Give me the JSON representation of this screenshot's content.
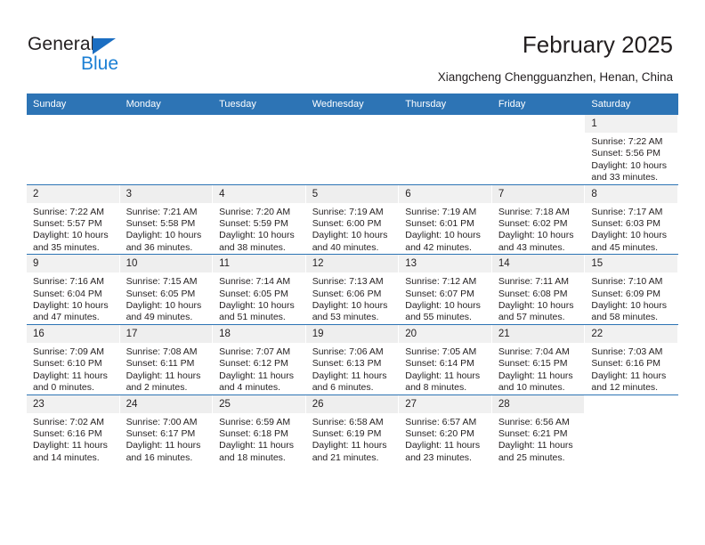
{
  "brand": {
    "name_primary": "General",
    "name_secondary": "Blue",
    "accent_color": "#1b7fd4",
    "triangle_color": "#1b6ec2"
  },
  "header": {
    "title": "February 2025",
    "location": "Xiangcheng Chengguanzhen, Henan, China"
  },
  "theme": {
    "header_blue": "#2d74b5",
    "daynum_band": "#f1f1f1",
    "text": "#231f20"
  },
  "weekdays": [
    "Sunday",
    "Monday",
    "Tuesday",
    "Wednesday",
    "Thursday",
    "Friday",
    "Saturday"
  ],
  "labels": {
    "sunrise": "Sunrise:",
    "sunset": "Sunset:",
    "daylight": "Daylight:"
  },
  "weeks": [
    [
      {
        "day": "",
        "sunrise": "",
        "sunset": "",
        "daylight": "",
        "empty": true
      },
      {
        "day": "",
        "sunrise": "",
        "sunset": "",
        "daylight": "",
        "empty": true
      },
      {
        "day": "",
        "sunrise": "",
        "sunset": "",
        "daylight": "",
        "empty": true
      },
      {
        "day": "",
        "sunrise": "",
        "sunset": "",
        "daylight": "",
        "empty": true
      },
      {
        "day": "",
        "sunrise": "",
        "sunset": "",
        "daylight": "",
        "empty": true
      },
      {
        "day": "",
        "sunrise": "",
        "sunset": "",
        "daylight": "",
        "empty": true
      },
      {
        "day": "1",
        "sunrise": "Sunrise: 7:22 AM",
        "sunset": "Sunset: 5:56 PM",
        "daylight": "Daylight: 10 hours and 33 minutes."
      }
    ],
    [
      {
        "day": "2",
        "sunrise": "Sunrise: 7:22 AM",
        "sunset": "Sunset: 5:57 PM",
        "daylight": "Daylight: 10 hours and 35 minutes."
      },
      {
        "day": "3",
        "sunrise": "Sunrise: 7:21 AM",
        "sunset": "Sunset: 5:58 PM",
        "daylight": "Daylight: 10 hours and 36 minutes."
      },
      {
        "day": "4",
        "sunrise": "Sunrise: 7:20 AM",
        "sunset": "Sunset: 5:59 PM",
        "daylight": "Daylight: 10 hours and 38 minutes."
      },
      {
        "day": "5",
        "sunrise": "Sunrise: 7:19 AM",
        "sunset": "Sunset: 6:00 PM",
        "daylight": "Daylight: 10 hours and 40 minutes."
      },
      {
        "day": "6",
        "sunrise": "Sunrise: 7:19 AM",
        "sunset": "Sunset: 6:01 PM",
        "daylight": "Daylight: 10 hours and 42 minutes."
      },
      {
        "day": "7",
        "sunrise": "Sunrise: 7:18 AM",
        "sunset": "Sunset: 6:02 PM",
        "daylight": "Daylight: 10 hours and 43 minutes."
      },
      {
        "day": "8",
        "sunrise": "Sunrise: 7:17 AM",
        "sunset": "Sunset: 6:03 PM",
        "daylight": "Daylight: 10 hours and 45 minutes."
      }
    ],
    [
      {
        "day": "9",
        "sunrise": "Sunrise: 7:16 AM",
        "sunset": "Sunset: 6:04 PM",
        "daylight": "Daylight: 10 hours and 47 minutes."
      },
      {
        "day": "10",
        "sunrise": "Sunrise: 7:15 AM",
        "sunset": "Sunset: 6:05 PM",
        "daylight": "Daylight: 10 hours and 49 minutes."
      },
      {
        "day": "11",
        "sunrise": "Sunrise: 7:14 AM",
        "sunset": "Sunset: 6:05 PM",
        "daylight": "Daylight: 10 hours and 51 minutes."
      },
      {
        "day": "12",
        "sunrise": "Sunrise: 7:13 AM",
        "sunset": "Sunset: 6:06 PM",
        "daylight": "Daylight: 10 hours and 53 minutes."
      },
      {
        "day": "13",
        "sunrise": "Sunrise: 7:12 AM",
        "sunset": "Sunset: 6:07 PM",
        "daylight": "Daylight: 10 hours and 55 minutes."
      },
      {
        "day": "14",
        "sunrise": "Sunrise: 7:11 AM",
        "sunset": "Sunset: 6:08 PM",
        "daylight": "Daylight: 10 hours and 57 minutes."
      },
      {
        "day": "15",
        "sunrise": "Sunrise: 7:10 AM",
        "sunset": "Sunset: 6:09 PM",
        "daylight": "Daylight: 10 hours and 58 minutes."
      }
    ],
    [
      {
        "day": "16",
        "sunrise": "Sunrise: 7:09 AM",
        "sunset": "Sunset: 6:10 PM",
        "daylight": "Daylight: 11 hours and 0 minutes."
      },
      {
        "day": "17",
        "sunrise": "Sunrise: 7:08 AM",
        "sunset": "Sunset: 6:11 PM",
        "daylight": "Daylight: 11 hours and 2 minutes."
      },
      {
        "day": "18",
        "sunrise": "Sunrise: 7:07 AM",
        "sunset": "Sunset: 6:12 PM",
        "daylight": "Daylight: 11 hours and 4 minutes."
      },
      {
        "day": "19",
        "sunrise": "Sunrise: 7:06 AM",
        "sunset": "Sunset: 6:13 PM",
        "daylight": "Daylight: 11 hours and 6 minutes."
      },
      {
        "day": "20",
        "sunrise": "Sunrise: 7:05 AM",
        "sunset": "Sunset: 6:14 PM",
        "daylight": "Daylight: 11 hours and 8 minutes."
      },
      {
        "day": "21",
        "sunrise": "Sunrise: 7:04 AM",
        "sunset": "Sunset: 6:15 PM",
        "daylight": "Daylight: 11 hours and 10 minutes."
      },
      {
        "day": "22",
        "sunrise": "Sunrise: 7:03 AM",
        "sunset": "Sunset: 6:16 PM",
        "daylight": "Daylight: 11 hours and 12 minutes."
      }
    ],
    [
      {
        "day": "23",
        "sunrise": "Sunrise: 7:02 AM",
        "sunset": "Sunset: 6:16 PM",
        "daylight": "Daylight: 11 hours and 14 minutes."
      },
      {
        "day": "24",
        "sunrise": "Sunrise: 7:00 AM",
        "sunset": "Sunset: 6:17 PM",
        "daylight": "Daylight: 11 hours and 16 minutes."
      },
      {
        "day": "25",
        "sunrise": "Sunrise: 6:59 AM",
        "sunset": "Sunset: 6:18 PM",
        "daylight": "Daylight: 11 hours and 18 minutes."
      },
      {
        "day": "26",
        "sunrise": "Sunrise: 6:58 AM",
        "sunset": "Sunset: 6:19 PM",
        "daylight": "Daylight: 11 hours and 21 minutes."
      },
      {
        "day": "27",
        "sunrise": "Sunrise: 6:57 AM",
        "sunset": "Sunset: 6:20 PM",
        "daylight": "Daylight: 11 hours and 23 minutes."
      },
      {
        "day": "28",
        "sunrise": "Sunrise: 6:56 AM",
        "sunset": "Sunset: 6:21 PM",
        "daylight": "Daylight: 11 hours and 25 minutes."
      },
      {
        "day": "",
        "sunrise": "",
        "sunset": "",
        "daylight": "",
        "empty": true
      }
    ]
  ]
}
